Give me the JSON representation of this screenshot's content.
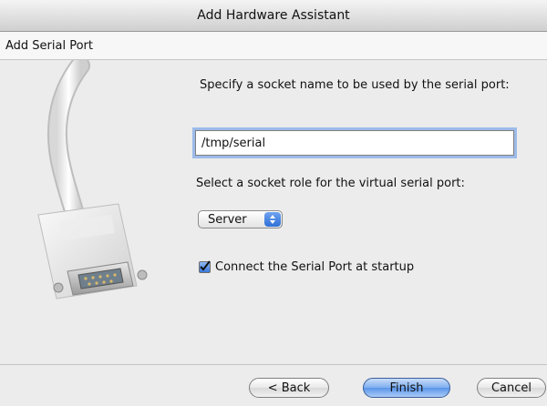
{
  "window": {
    "title": "Add Hardware Assistant"
  },
  "step": {
    "title": "Add Serial Port"
  },
  "form": {
    "socket_name_prompt": "Specify a socket name to be used by the serial port:",
    "socket_name_value": "/tmp/serial",
    "socket_role_prompt": "Select a socket role for the virtual serial port:",
    "socket_role_selected": "Server",
    "connect_at_startup_label": "Connect the Serial Port at startup",
    "connect_at_startup_checked": true
  },
  "buttons": {
    "back_label": "< Back",
    "finish_label": "Finish",
    "cancel_label": "Cancel"
  },
  "icons": {
    "illustration": "serial-cable-connector-icon",
    "select_arrows": "up-down-arrows-icon",
    "checkmark": "checkmark-icon"
  },
  "colors": {
    "accent_blue": "#5a95ea",
    "focus_ring": "#9cbbe9"
  }
}
